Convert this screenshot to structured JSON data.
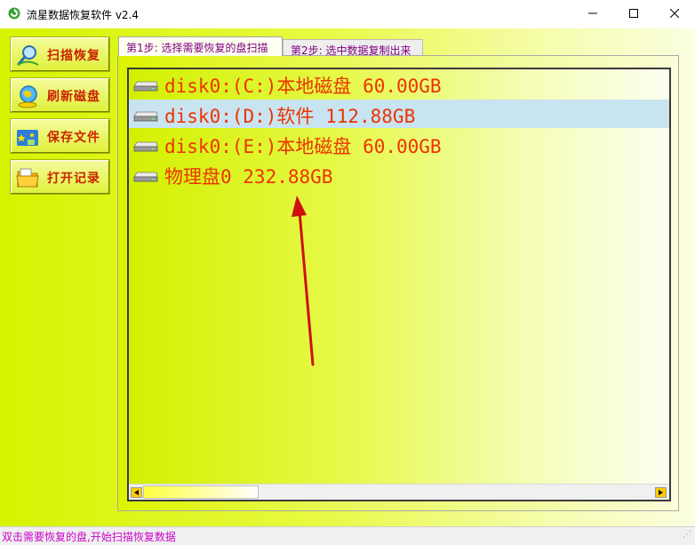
{
  "window": {
    "title": "流星数据恢复软件 v2.4"
  },
  "sidebar": {
    "buttons": [
      {
        "label": "扫描恢复",
        "icon": "magnifier-icon"
      },
      {
        "label": "刷新磁盘",
        "icon": "refresh-globe-icon"
      },
      {
        "label": "保存文件",
        "icon": "save-stars-icon"
      },
      {
        "label": "打开记录",
        "icon": "folder-icon"
      }
    ]
  },
  "tabs": [
    {
      "label": "第1步: 选择需要恢复的盘扫描"
    },
    {
      "label": "第2步: 选中数据复制出来"
    }
  ],
  "disks": [
    {
      "label": "disk0:(C:)本地磁盘 60.00GB",
      "selected": false
    },
    {
      "label": "disk0:(D:)软件 112.88GB",
      "selected": true
    },
    {
      "label": "disk0:(E:)本地磁盘 60.00GB",
      "selected": false
    },
    {
      "label": "物理盘0 232.88GB",
      "selected": false
    }
  ],
  "status": {
    "text": "双击需要恢复的盘,开始扫描恢复数据"
  },
  "colors": {
    "accent_text": "#ee3300",
    "selection": "#c8e4f0",
    "status_text": "#cc00cc",
    "annotation_arrow": "#d01010"
  }
}
